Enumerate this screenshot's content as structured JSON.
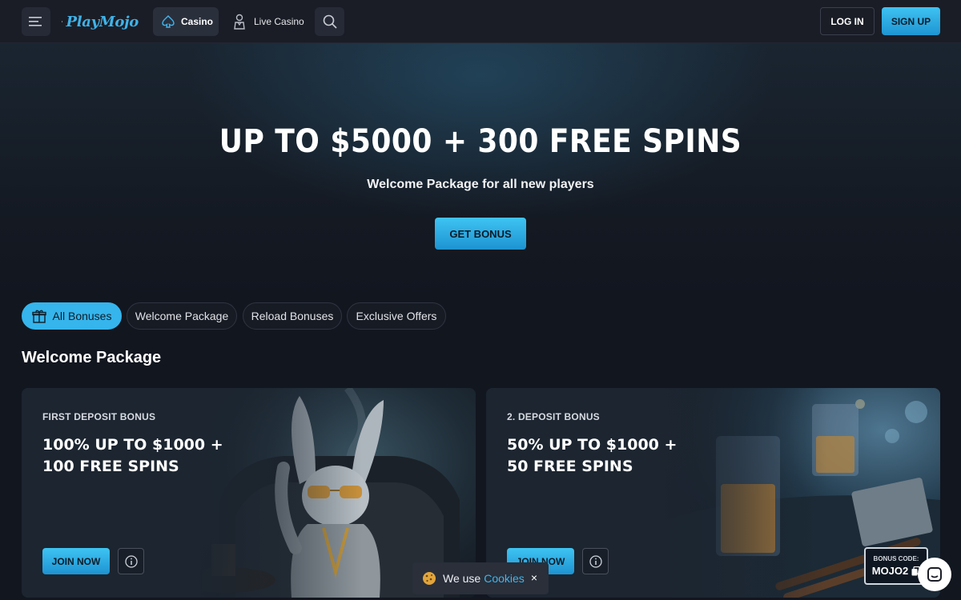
{
  "header": {
    "logo_text": "PlayMojo",
    "nav": {
      "casino": "Casino",
      "live_casino": "Live Casino"
    },
    "login": "LOG IN",
    "signup": "SIGN UP"
  },
  "hero": {
    "title": "UP TO $5000 + 300 FREE SPINS",
    "subtitle": "Welcome Package for all new players",
    "cta": "GET BONUS"
  },
  "filters": [
    {
      "label": "All Bonuses",
      "active": true
    },
    {
      "label": "Welcome Package",
      "active": false
    },
    {
      "label": "Reload Bonuses",
      "active": false
    },
    {
      "label": "Exclusive Offers",
      "active": false
    }
  ],
  "section_title": "Welcome Package",
  "cards": [
    {
      "kicker": "FIRST DEPOSIT BONUS",
      "line1": "100% UP TO $1000 +",
      "line2": "100 FREE SPINS",
      "cta": "JOIN NOW"
    },
    {
      "kicker": "2. DEPOSIT BONUS",
      "line1": "50% UP TO $1000 +",
      "line2": "50 FREE SPINS",
      "cta": "JOIN NOW"
    }
  ],
  "bonus_code": {
    "label": "BONUS CODE:",
    "value": "MOJO2"
  },
  "cookie": {
    "text": "We use",
    "link": "Cookies",
    "close": "×"
  },
  "colors": {
    "accent": "#35b5ec",
    "background": "#12161f",
    "header": "#1a1d26"
  }
}
